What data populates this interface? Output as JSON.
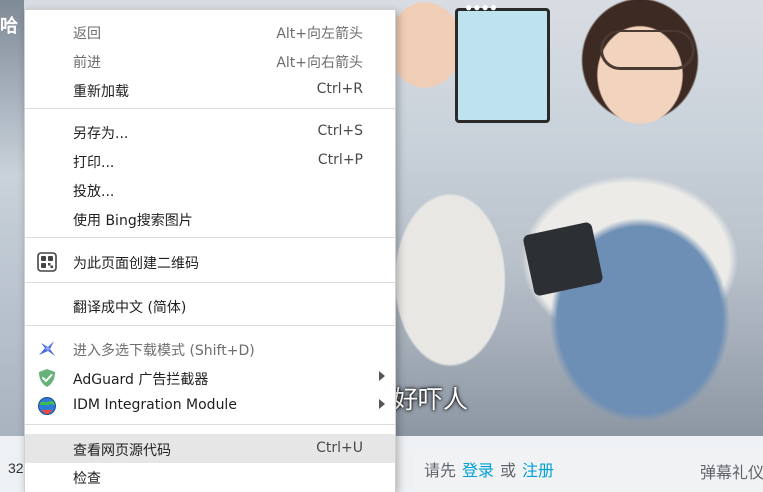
{
  "menu": {
    "back": {
      "label": "返回",
      "shortcut": "Alt+向左箭头"
    },
    "forward": {
      "label": "前进",
      "shortcut": "Alt+向右箭头"
    },
    "reload": {
      "label": "重新加载",
      "shortcut": "Ctrl+R"
    },
    "save_as": {
      "label": "另存为...",
      "shortcut": "Ctrl+S"
    },
    "print": {
      "label": "打印...",
      "shortcut": "Ctrl+P"
    },
    "cast": {
      "label": "投放..."
    },
    "bing_image_search": {
      "label": "使用 Bing搜索图片"
    },
    "qr_code": {
      "label": "为此页面创建二维码"
    },
    "translate": {
      "label": "翻译成中文 (简体)"
    },
    "multi_download": {
      "label": "进入多选下载模式 (Shift+D)"
    },
    "adguard": {
      "label": "AdGuard 广告拦截器"
    },
    "idm": {
      "label": "IDM Integration Module"
    },
    "view_source": {
      "label": "查看网页源代码",
      "shortcut": "Ctrl+U"
    },
    "inspect": {
      "label": "检查"
    }
  },
  "video": {
    "subtitle": "你好吓人",
    "corner_text": "哈"
  },
  "danmaku": {
    "prefix": "请先",
    "login": "登录",
    "or": "或",
    "register": "注册",
    "gift": "弹幕礼仪"
  },
  "page": {
    "count_partial": "32"
  },
  "colors": {
    "link": "#00a1d6",
    "menu_highlight": "#e6e6e6",
    "adguard_green": "#67b279"
  },
  "icons": {
    "qr_code": "qr-code-icon",
    "multi_download": "bird-download-icon",
    "adguard": "adguard-shield-icon",
    "idm": "idm-globe-icon",
    "submenu": "chevron-right-icon"
  }
}
